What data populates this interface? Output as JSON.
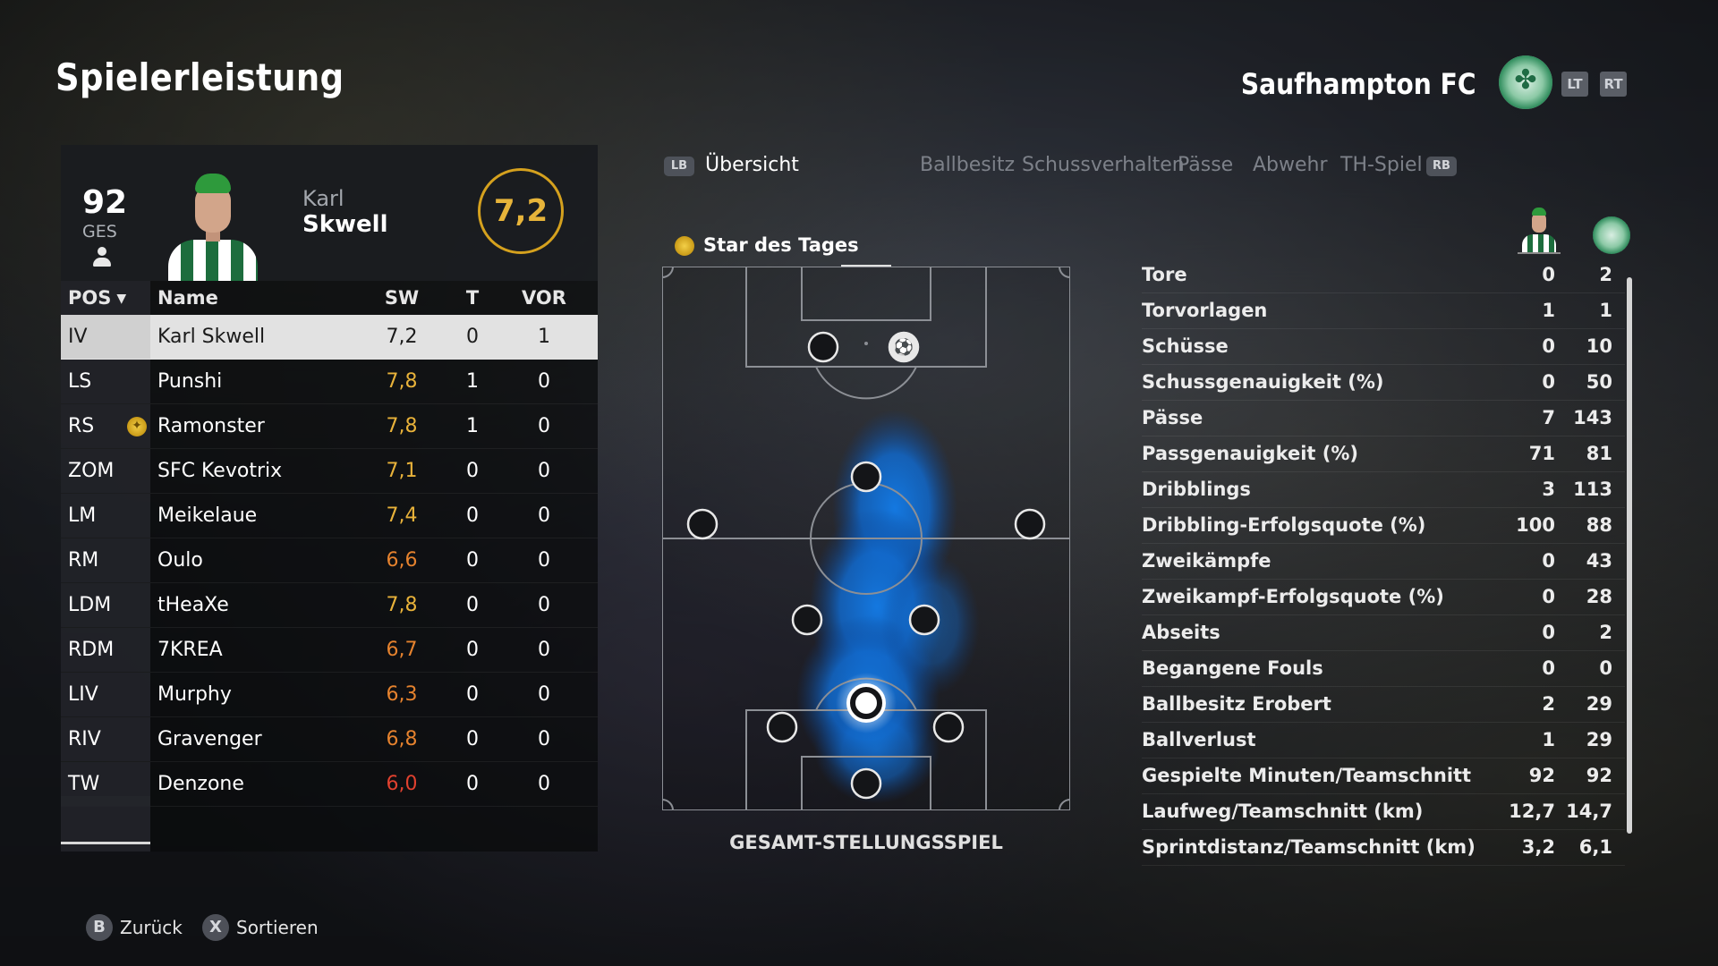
{
  "page": {
    "title": "Spielerleistung"
  },
  "team": {
    "name": "Saufhampton FC",
    "lt_label": "LT",
    "rt_label": "RT"
  },
  "player": {
    "overall": "92",
    "overall_label": "GES",
    "first_name": "Karl",
    "last_name": "Skwell",
    "rating": "7,2"
  },
  "table": {
    "headers": {
      "pos": "POS",
      "name": "Name",
      "sw": "SW",
      "t": "T",
      "vor": "VOR"
    },
    "rows": [
      {
        "pos": "IV",
        "name": "Karl Skwell",
        "sw": "7,2",
        "t": "0",
        "vor": "1",
        "color": "#1b1b1b",
        "selected": true
      },
      {
        "pos": "LS",
        "name": "Punshi",
        "sw": "7,8",
        "t": "1",
        "vor": "0",
        "color": "#e8b23a"
      },
      {
        "pos": "RS",
        "name": "Ramonster",
        "sw": "7,8",
        "t": "1",
        "vor": "0",
        "color": "#e8b23a",
        "star": true
      },
      {
        "pos": "ZOM",
        "name": "SFC Kevotrix",
        "sw": "7,1",
        "t": "0",
        "vor": "0",
        "color": "#e8b23a"
      },
      {
        "pos": "LM",
        "name": "Meikelaue",
        "sw": "7,4",
        "t": "0",
        "vor": "0",
        "color": "#e8b23a"
      },
      {
        "pos": "RM",
        "name": "Oulo",
        "sw": "6,6",
        "t": "0",
        "vor": "0",
        "color": "#e5822e"
      },
      {
        "pos": "LDM",
        "name": "tHeaXe",
        "sw": "7,8",
        "t": "0",
        "vor": "0",
        "color": "#e8b23a"
      },
      {
        "pos": "RDM",
        "name": "7KREA",
        "sw": "6,7",
        "t": "0",
        "vor": "0",
        "color": "#e5822e"
      },
      {
        "pos": "LIV",
        "name": "Murphy",
        "sw": "6,3",
        "t": "0",
        "vor": "0",
        "color": "#e5822e"
      },
      {
        "pos": "RIV",
        "name": "Gravenger",
        "sw": "6,8",
        "t": "0",
        "vor": "0",
        "color": "#e5822e"
      },
      {
        "pos": "TW",
        "name": "Denzone",
        "sw": "6,0",
        "t": "0",
        "vor": "0",
        "color": "#e0412f"
      }
    ]
  },
  "tabs": {
    "lb_label": "LB",
    "rb_label": "RB",
    "items": [
      {
        "label": "Übersicht",
        "active": true
      },
      {
        "label": "Ballbesitz"
      },
      {
        "label": "Schussverhalten"
      },
      {
        "label": "Pässe"
      },
      {
        "label": "Abwehr"
      },
      {
        "label": "TH-Spiel"
      }
    ]
  },
  "pitch": {
    "star_title": "Star des Tages",
    "caption": "GESAMT-STELLUNGSSPIEL"
  },
  "stats": [
    {
      "label": "Tore",
      "player": "0",
      "team": "2"
    },
    {
      "label": "Torvorlagen",
      "player": "1",
      "team": "1"
    },
    {
      "label": "Schüsse",
      "player": "0",
      "team": "10"
    },
    {
      "label": "Schussgenauigkeit (%)",
      "player": "0",
      "team": "50"
    },
    {
      "label": "Pässe",
      "player": "7",
      "team": "143"
    },
    {
      "label": "Passgenauigkeit (%)",
      "player": "71",
      "team": "81"
    },
    {
      "label": "Dribblings",
      "player": "3",
      "team": "113"
    },
    {
      "label": "Dribbling-Erfolgsquote (%)",
      "player": "100",
      "team": "88"
    },
    {
      "label": "Zweikämpfe",
      "player": "0",
      "team": "43"
    },
    {
      "label": "Zweikampf-Erfolgsquote (%)",
      "player": "0",
      "team": "28"
    },
    {
      "label": "Abseits",
      "player": "0",
      "team": "2"
    },
    {
      "label": "Begangene Fouls",
      "player": "0",
      "team": "0"
    },
    {
      "label": "Ballbesitz Erobert",
      "player": "2",
      "team": "29"
    },
    {
      "label": "Ballverlust",
      "player": "1",
      "team": "29"
    },
    {
      "label": "Gespielte Minuten/Teamschnitt",
      "player": "92",
      "team": "92"
    },
    {
      "label": "Laufweg/Teamschnitt (km)",
      "player": "12,7",
      "team": "14,7"
    },
    {
      "label": "Sprintdistanz/Teamschnitt (km)",
      "player": "3,2",
      "team": "6,1"
    }
  ],
  "footer": {
    "back_button": "B",
    "back_label": "Zurück",
    "sort_button": "X",
    "sort_label": "Sortieren"
  },
  "colors": {
    "accent_gold": "#d5a11e",
    "heatmap_blue": "#1478e0",
    "crest_green": "#2f8c5c"
  }
}
